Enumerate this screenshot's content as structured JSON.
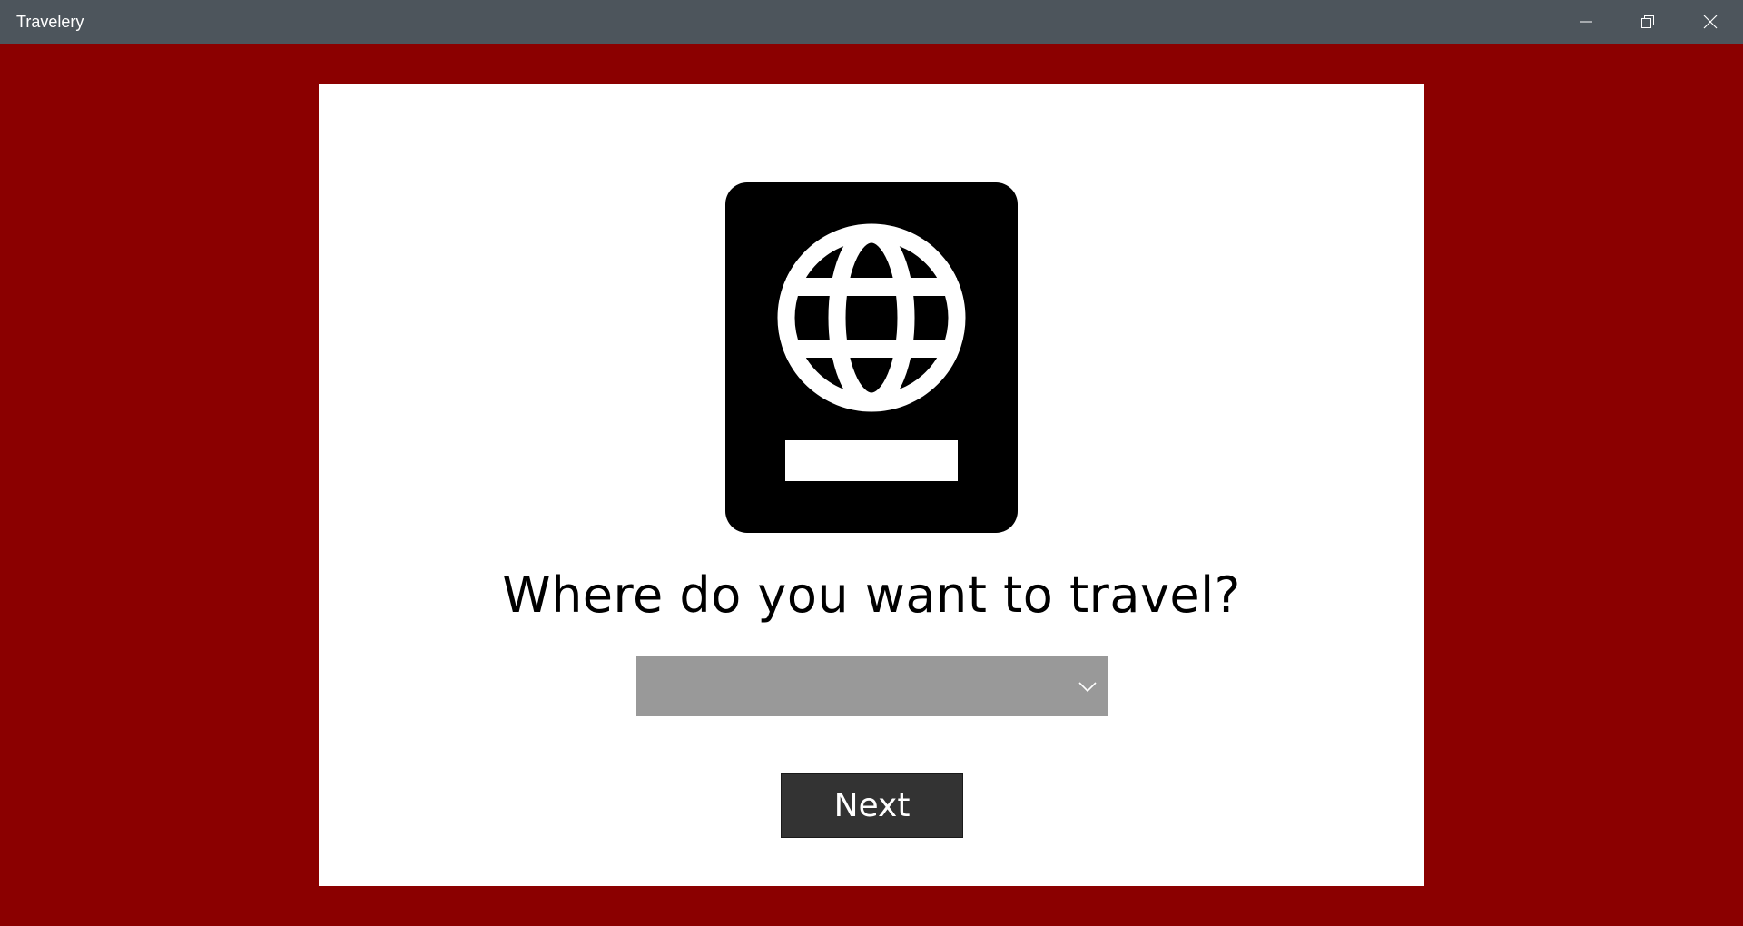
{
  "window": {
    "title": "Travelery",
    "controls": {
      "minimize_icon": "minimize-icon",
      "maximize_icon": "restore-icon",
      "close_icon": "close-icon"
    }
  },
  "colors": {
    "titlebar": "#4d555c",
    "background": "#8b0000",
    "card": "#ffffff",
    "dropdown": "#999999",
    "button": "#333333"
  },
  "main": {
    "icon": "passport-globe-icon",
    "question": "Where do you want to travel?",
    "destination_select": {
      "selected_value": "",
      "icon": "chevron-down-icon"
    },
    "next_label": "Next"
  }
}
